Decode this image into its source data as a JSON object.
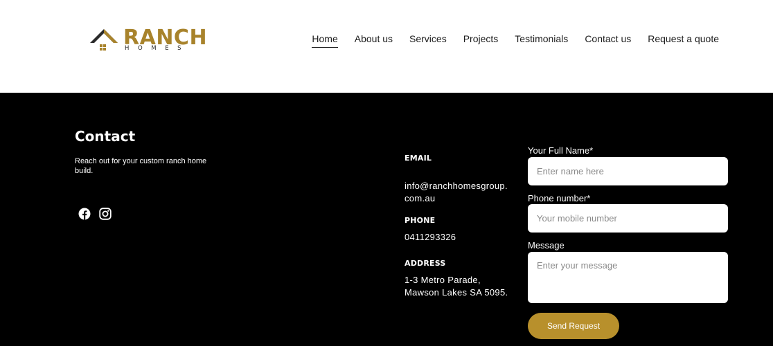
{
  "brand": {
    "name": "RANCH",
    "sub": "HOMES",
    "gold": "#a8832c"
  },
  "nav": {
    "items": [
      {
        "label": "Home",
        "active": true
      },
      {
        "label": "About us"
      },
      {
        "label": "Services"
      },
      {
        "label": "Projects"
      },
      {
        "label": "Testimonials"
      },
      {
        "label": "Contact us"
      },
      {
        "label": "Request a quote"
      }
    ]
  },
  "contact": {
    "title": "Contact",
    "subtitle": "Reach out for your custom ranch home build.",
    "social": [
      "facebook-icon",
      "instagram-icon"
    ]
  },
  "info": {
    "email_label": "EMAIL",
    "email_line1": "info@ranchhomesgroup.",
    "email_line2": "com.au",
    "phone_label": "PHONE",
    "phone": "0411293326",
    "address_label": "ADDRESS",
    "address_line1": "1-3 Metro Parade,",
    "address_line2": "Mawson Lakes SA 5095."
  },
  "form": {
    "name_label": "Your Full Name*",
    "name_placeholder": "Enter name here",
    "phone_label": "Phone number*",
    "phone_placeholder": "Your mobile number",
    "message_label": "Message",
    "message_placeholder": "Enter your message",
    "submit_label": "Send Request",
    "accent": "#b8902c"
  }
}
